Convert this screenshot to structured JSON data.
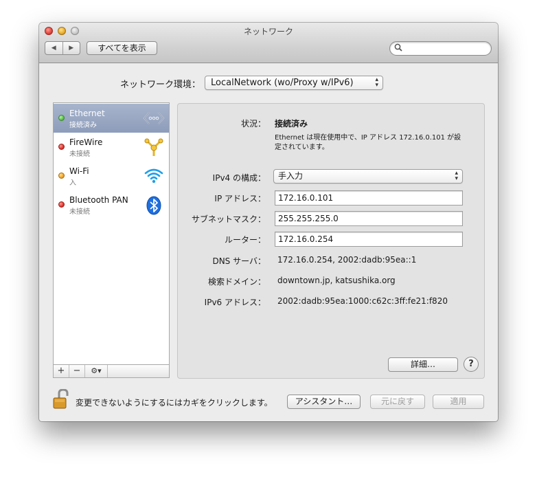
{
  "window": {
    "title": "ネットワーク",
    "nav_back": "◀",
    "nav_forward": "▶",
    "show_all": "すべてを表示",
    "search_placeholder": ""
  },
  "location": {
    "label": "ネットワーク環境：",
    "value": "LocalNetwork (wo/Proxy w/IPv6)"
  },
  "services": [
    {
      "name": "Ethernet",
      "status": "接続済み",
      "indicator": "#5cc24a",
      "icon": "ethernet-icon",
      "selected": true
    },
    {
      "name": "FireWire",
      "status": "未接続",
      "indicator": "#e0322b",
      "icon": "firewire-icon",
      "selected": false
    },
    {
      "name": "Wi-Fi",
      "status": "入",
      "indicator": "#f0a22a",
      "icon": "wifi-icon",
      "selected": false
    },
    {
      "name": "Bluetooth PAN",
      "status": "未接続",
      "indicator": "#e0322b",
      "icon": "bluetooth-icon",
      "selected": false
    }
  ],
  "sidebar_buttons": {
    "add": "+",
    "remove": "−",
    "gear": "⚙▾"
  },
  "detail": {
    "status_label": "状況：",
    "status_value": "接続済み",
    "status_desc_line1": "Ethernet は現在使用中で、IP アドレス 172.16.0.101 が設",
    "status_desc_line2": "定されています。",
    "ipv4_label": "IPv4 の構成：",
    "ipv4_value": "手入力",
    "ip_label": "IP アドレス：",
    "ip_value": "172.16.0.101",
    "subnet_label": "サブネットマスク：",
    "subnet_value": "255.255.255.0",
    "router_label": "ルーター：",
    "router_value": "172.16.0.254",
    "dns_label": "DNS サーバ：",
    "dns_value": "172.16.0.254, 2002:dadb:95ea::1",
    "search_domain_label": "検索ドメイン：",
    "search_domain_value": "downtown.jp, katsushika.org",
    "ipv6_label": "IPv6 アドレス：",
    "ipv6_value": "2002:dadb:95ea:1000:c62c:3ff:fe21:f820",
    "advanced_button": "詳細…",
    "help_button": "?"
  },
  "footer": {
    "lock_message": "変更できないようにするにはカギをクリックします。",
    "assist_button": "アシスタント…",
    "revert_button": "元に戻す",
    "apply_button": "適用"
  },
  "colors": {
    "selection": "#95a3bf",
    "connected": "#5cc24a",
    "disconnected": "#e0322b",
    "wifi_on": "#f0a22a",
    "wifi_icon": "#1f9fe8",
    "bluetooth_icon": "#1f6fe0"
  }
}
